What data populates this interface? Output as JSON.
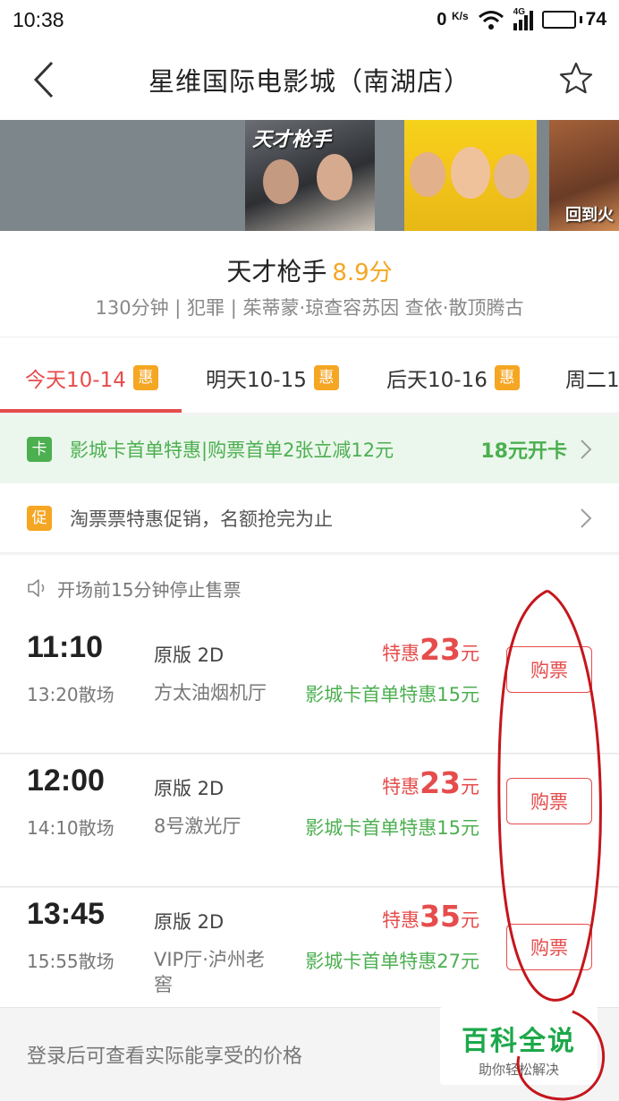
{
  "status_bar": {
    "time": "10:38",
    "network_speed": "0",
    "network_unit": "K/s",
    "signal_type": "4G",
    "battery": "74"
  },
  "header": {
    "title": "星维国际电影城（南湖店）"
  },
  "posters": [
    {
      "title": "天才枪手"
    },
    {
      "title": ""
    },
    {
      "title": "回到火"
    }
  ],
  "movie": {
    "name": "天才枪手",
    "score": "8.9分",
    "meta": "130分钟 | 犯罪 | 茱蒂蒙·琼查容苏因 查依·散顶腾古"
  },
  "date_tabs": [
    {
      "label": "今天10-14",
      "badge": "惠",
      "active": true
    },
    {
      "label": "明天10-15",
      "badge": "惠",
      "active": false
    },
    {
      "label": "后天10-16",
      "badge": "惠",
      "active": false
    },
    {
      "label": "周二1",
      "badge": "",
      "active": false
    }
  ],
  "promo_card": {
    "badge": "卡",
    "text": "影城卡首单特惠|购票首单2张立减12元",
    "cta": "18元开卡"
  },
  "promo_sale": {
    "badge": "促",
    "text": "淘票票特惠促销，名额抢完为止"
  },
  "notice": {
    "text": "开场前15分钟停止售票"
  },
  "showtimes": [
    {
      "start": "11:10",
      "end": "13:20散场",
      "version": "原版 2D",
      "hall": "方太油烟机厅",
      "price_prefix": "特惠",
      "price": "23",
      "price_unit": "元",
      "discount": "影城卡首单特惠15元",
      "buy": "购票"
    },
    {
      "start": "12:00",
      "end": "14:10散场",
      "version": "原版 2D",
      "hall": "8号激光厅",
      "price_prefix": "特惠",
      "price": "23",
      "price_unit": "元",
      "discount": "影城卡首单特惠15元",
      "buy": "购票"
    },
    {
      "start": "13:45",
      "end": "15:55散场",
      "version": "原版 2D",
      "hall": "VIP厅·泸州老窖",
      "price_prefix": "特惠",
      "price": "35",
      "price_unit": "元",
      "discount": "影城卡首单特惠27元",
      "buy": "购票"
    }
  ],
  "login_tip": "登录后可查看实际能享受的价格",
  "watermark": {
    "title": "百科全说",
    "subtitle": "助你轻松解决"
  },
  "colors": {
    "accent_red": "#e64c4c",
    "promo_green": "#4caf50",
    "badge_orange": "#f5a623",
    "score_gold": "#f4a623",
    "annotation_red": "#c4161c"
  }
}
